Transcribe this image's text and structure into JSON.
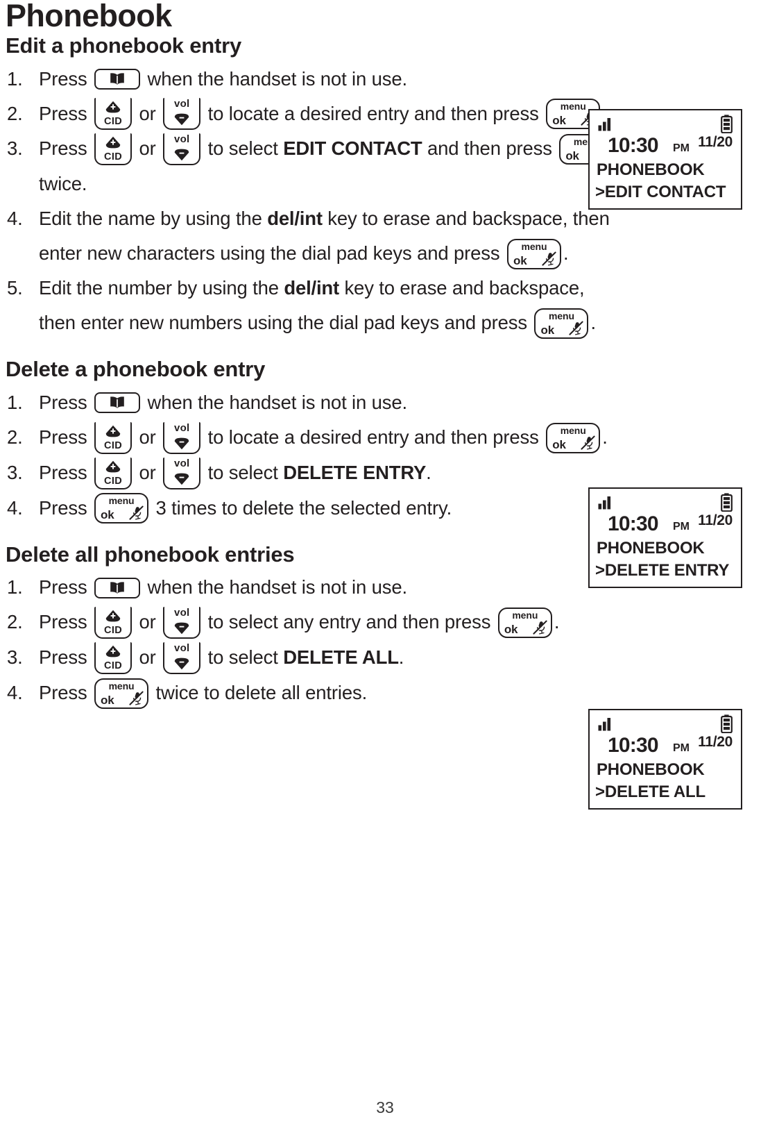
{
  "document": {
    "title": "Phonebook",
    "page_number": "33"
  },
  "keys": {
    "phonebook": {
      "icon": "open-book-icon",
      "label": ""
    },
    "cid_up": {
      "icon": "up-triangle-icon",
      "label": "CID"
    },
    "vol_down": {
      "icon": "down-triangle-icon",
      "label": "vol"
    },
    "menu_ok": {
      "line1": "menu",
      "line2": "ok",
      "icon": "mute-microphone-icon"
    }
  },
  "sections": [
    {
      "heading": "Edit a phonebook entry",
      "steps": [
        {
          "num": "1.",
          "parts": [
            {
              "t": "text",
              "v": "Press "
            },
            {
              "t": "key",
              "v": "phonebook"
            },
            {
              "t": "text",
              "v": " when the handset is not in use."
            }
          ]
        },
        {
          "num": "2.",
          "parts": [
            {
              "t": "text",
              "v": "Press "
            },
            {
              "t": "key",
              "v": "cid_up"
            },
            {
              "t": "text",
              "v": " or "
            },
            {
              "t": "key",
              "v": "vol_down"
            },
            {
              "t": "text",
              "v": " to locate a desired entry and then press "
            },
            {
              "t": "key",
              "v": "menu_ok"
            },
            {
              "t": "text",
              "v": "."
            }
          ]
        },
        {
          "num": "3.",
          "parts": [
            {
              "t": "text",
              "v": "Press "
            },
            {
              "t": "key",
              "v": "cid_up"
            },
            {
              "t": "text",
              "v": " or "
            },
            {
              "t": "key",
              "v": "vol_down"
            },
            {
              "t": "text",
              "v": " to select "
            },
            {
              "t": "bold",
              "v": "EDIT CONTACT"
            },
            {
              "t": "text",
              "v": " and then press "
            },
            {
              "t": "key",
              "v": "menu_ok"
            },
            {
              "t": "text",
              "v": " twice."
            }
          ]
        },
        {
          "num": "4.",
          "parts": [
            {
              "t": "text",
              "v": "Edit the name by using the "
            },
            {
              "t": "bold",
              "v": "del/int"
            },
            {
              "t": "text",
              "v": " key to erase and backspace, then enter new characters using the dial pad keys and press "
            },
            {
              "t": "key",
              "v": "menu_ok"
            },
            {
              "t": "text",
              "v": "."
            }
          ]
        },
        {
          "num": "5.",
          "parts": [
            {
              "t": "text",
              "v": "Edit the number by using the "
            },
            {
              "t": "bold",
              "v": "del/int"
            },
            {
              "t": "text",
              "v": " key to erase and backspace, then enter new numbers using the dial pad keys and press "
            },
            {
              "t": "key",
              "v": "menu_ok"
            },
            {
              "t": "text",
              "v": "."
            }
          ]
        }
      ]
    },
    {
      "heading": "Delete a phonebook entry",
      "steps": [
        {
          "num": "1.",
          "parts": [
            {
              "t": "text",
              "v": "Press "
            },
            {
              "t": "key",
              "v": "phonebook"
            },
            {
              "t": "text",
              "v": " when the handset is not in use."
            }
          ]
        },
        {
          "num": "2.",
          "parts": [
            {
              "t": "text",
              "v": "Press "
            },
            {
              "t": "key",
              "v": "cid_up"
            },
            {
              "t": "text",
              "v": " or "
            },
            {
              "t": "key",
              "v": "vol_down"
            },
            {
              "t": "text",
              "v": " to locate a desired entry and then press "
            },
            {
              "t": "key",
              "v": "menu_ok"
            },
            {
              "t": "text",
              "v": "."
            }
          ]
        },
        {
          "num": "3.",
          "parts": [
            {
              "t": "text",
              "v": "Press "
            },
            {
              "t": "key",
              "v": "cid_up"
            },
            {
              "t": "text",
              "v": " or "
            },
            {
              "t": "key",
              "v": "vol_down"
            },
            {
              "t": "text",
              "v": " to select "
            },
            {
              "t": "bold",
              "v": "DELETE ENTRY"
            },
            {
              "t": "text",
              "v": "."
            }
          ]
        },
        {
          "num": "4.",
          "parts": [
            {
              "t": "text",
              "v": "Press "
            },
            {
              "t": "key",
              "v": "menu_ok"
            },
            {
              "t": "text",
              "v": " 3 times to delete the selected entry."
            }
          ]
        }
      ]
    },
    {
      "heading": "Delete all phonebook entries",
      "steps": [
        {
          "num": "1.",
          "parts": [
            {
              "t": "text",
              "v": "Press "
            },
            {
              "t": "key",
              "v": "phonebook"
            },
            {
              "t": "text",
              "v": " when the handset is not in use."
            }
          ]
        },
        {
          "num": "2.",
          "parts": [
            {
              "t": "text",
              "v": "Press "
            },
            {
              "t": "key",
              "v": "cid_up"
            },
            {
              "t": "text",
              "v": " or "
            },
            {
              "t": "key",
              "v": "vol_down"
            },
            {
              "t": "text",
              "v": " to select any entry and then press "
            },
            {
              "t": "key",
              "v": "menu_ok"
            },
            {
              "t": "text",
              "v": "."
            }
          ]
        },
        {
          "num": "3.",
          "parts": [
            {
              "t": "text",
              "v": "Press "
            },
            {
              "t": "key",
              "v": "cid_up"
            },
            {
              "t": "text",
              "v": " or "
            },
            {
              "t": "key",
              "v": "vol_down"
            },
            {
              "t": "text",
              "v": " to select "
            },
            {
              "t": "bold",
              "v": "DELETE ALL"
            },
            {
              "t": "text",
              "v": "."
            }
          ]
        },
        {
          "num": "4.",
          "parts": [
            {
              "t": "text",
              "v": "Press "
            },
            {
              "t": "key",
              "v": "menu_ok"
            },
            {
              "t": "text",
              "v": " twice to delete all entries."
            }
          ]
        }
      ]
    }
  ],
  "lcd_panels": [
    {
      "id": "lcd-1",
      "signal_icon": "signal-bars-icon",
      "battery_icon": "battery-icon",
      "time": "10:30",
      "ampm": "PM",
      "date": "11/20",
      "line1": "PHONEBOOK",
      "line2": ">EDIT CONTACT"
    },
    {
      "id": "lcd-2",
      "signal_icon": "signal-bars-icon",
      "battery_icon": "battery-icon",
      "time": "10:30",
      "ampm": "PM",
      "date": "11/20",
      "line1": "PHONEBOOK",
      "line2": ">DELETE ENTRY"
    },
    {
      "id": "lcd-3",
      "signal_icon": "signal-bars-icon",
      "battery_icon": "battery-icon",
      "time": "10:30",
      "ampm": "PM",
      "date": "11/20",
      "line1": "PHONEBOOK",
      "line2": ">DELETE ALL"
    }
  ],
  "colors": {
    "ink": "#231f20",
    "paper": "#ffffff"
  }
}
